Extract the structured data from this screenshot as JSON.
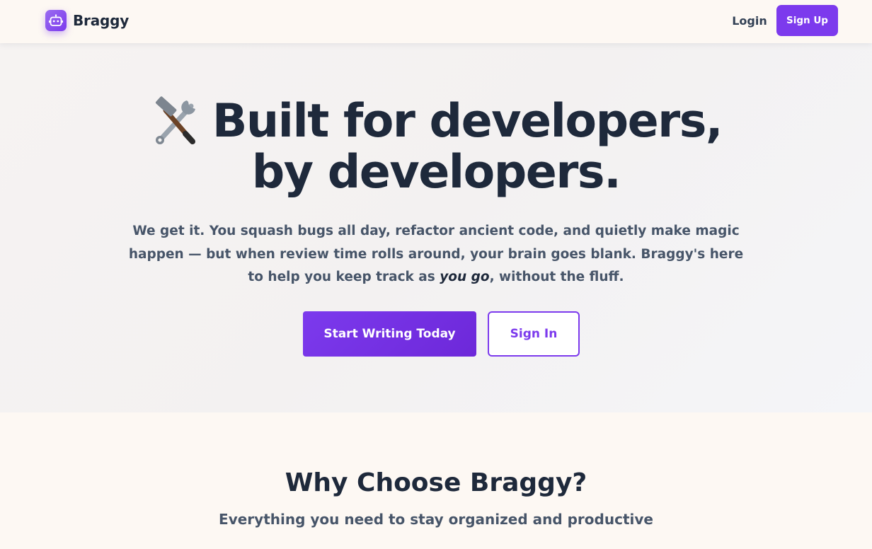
{
  "brand": {
    "name": "Braggy",
    "logo_icon": "robot-icon"
  },
  "nav": {
    "login_label": "Login",
    "signup_label": "Sign Up"
  },
  "hero": {
    "title_icon": "hammer-and-wrench-icon",
    "title_line1": "Built for developers,",
    "title_line2": "by developers.",
    "subtitle_part1": "We get it. You squash bugs all day, refactor ancient code, and quietly make magic happen — but when review time rolls around, your brain goes blank. Braggy's here to help you keep track as ",
    "subtitle_emphasis": "you go",
    "subtitle_part2": ", without the fluff.",
    "primary_cta": "Start Writing Today",
    "secondary_cta": "Sign In"
  },
  "features": {
    "title": "Why Choose Braggy?",
    "subtitle": "Everything you need to stay organized and productive"
  },
  "colors": {
    "accent": "#7c3aed",
    "text_dark": "#1e293b",
    "text_muted": "#475569",
    "background": "#fdf8f3"
  }
}
